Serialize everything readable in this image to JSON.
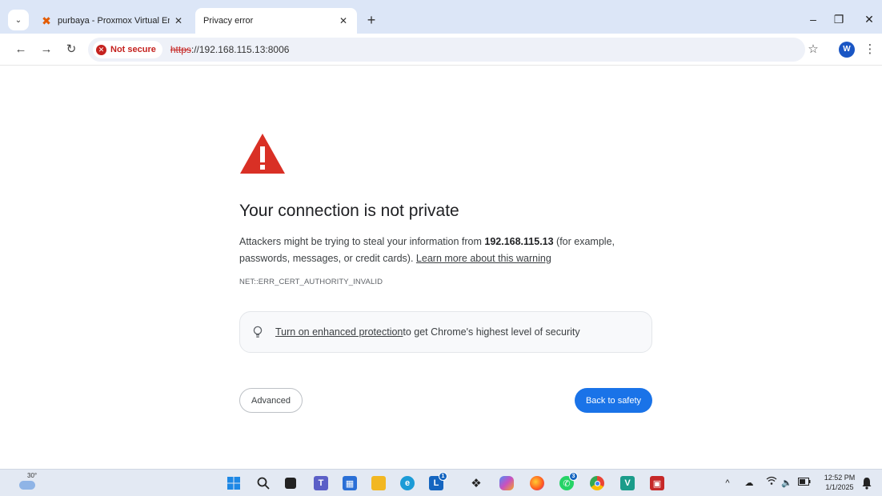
{
  "tabs": [
    {
      "title": "purbaya - Proxmox Virtual Enviro",
      "close": "✕",
      "active": false
    },
    {
      "title": "Privacy error",
      "close": "✕",
      "active": true
    }
  ],
  "tabstrip": {
    "menu": "⌄",
    "new_tab": "+"
  },
  "window": {
    "minimize": "–",
    "restore": "❐",
    "close": "✕"
  },
  "toolbar": {
    "back": "←",
    "forward": "→",
    "reload": "↻",
    "security_chip": "Not secure",
    "url_scheme": "https",
    "url_rest": "://192.168.115.13:8006",
    "bookmark": "☆",
    "profile_initial": "W",
    "menu": "⋮"
  },
  "page": {
    "headline": "Your connection is not private",
    "explain_pre": "Attackers might be trying to steal your information from ",
    "host": "192.168.115.13",
    "explain_post": " (for example, passwords, messages, or credit cards). ",
    "learn_more": "Learn more about this warning",
    "error_code": "NET::ERR_CERT_AUTHORITY_INVALID",
    "enhanced_link": "Turn on enhanced protection",
    "enhanced_text": " to get Chrome's highest level of security",
    "advanced_button": "Advanced",
    "back_button": "Back to safety"
  },
  "colors": {
    "accent": "#1a73e8",
    "danger": "#d93025",
    "not_secure": "#c5221f"
  },
  "taskbar": {
    "weather_temp": "30°",
    "icons": [
      "windows-start-icon",
      "search-icon",
      "task-view-icon",
      "teams-icon",
      "store-icon",
      "file-explorer-icon",
      "edge-icon",
      "launcher-icon",
      "dropbox-icon",
      "copilot-icon",
      "firefox-icon",
      "whatsapp-icon",
      "chrome-icon",
      "vscode-icon",
      "media-app-icon"
    ],
    "badges": {
      "launcher": "1",
      "whatsapp": "3"
    },
    "tray_chevron": "^",
    "clock_time": "12:52 PM",
    "clock_date": "1/1/2025"
  }
}
